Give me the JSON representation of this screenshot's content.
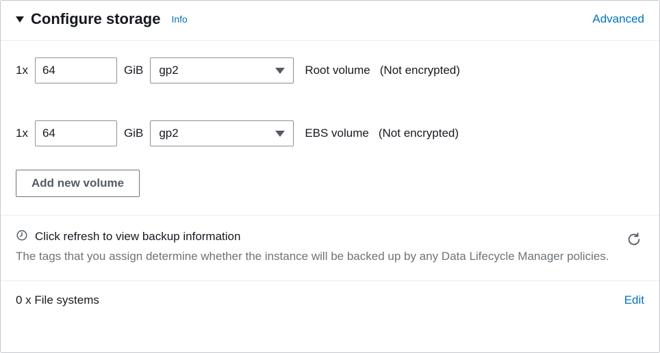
{
  "header": {
    "title": "Configure storage",
    "info": "Info",
    "advanced": "Advanced"
  },
  "volumes": [
    {
      "count": "1x",
      "size": "64",
      "unit": "GiB",
      "type": "gp2",
      "label": "Root volume",
      "encryption": "(Not encrypted)"
    },
    {
      "count": "1x",
      "size": "64",
      "unit": "GiB",
      "type": "gp2",
      "label": "EBS volume",
      "encryption": "(Not encrypted)"
    }
  ],
  "addVolume": "Add new volume",
  "backup": {
    "title": "Click refresh to view backup information",
    "description": "The tags that you assign determine whether the instance will be backed up by any Data Lifecycle Manager policies."
  },
  "filesystems": {
    "label": "0 x File systems",
    "edit": "Edit"
  }
}
